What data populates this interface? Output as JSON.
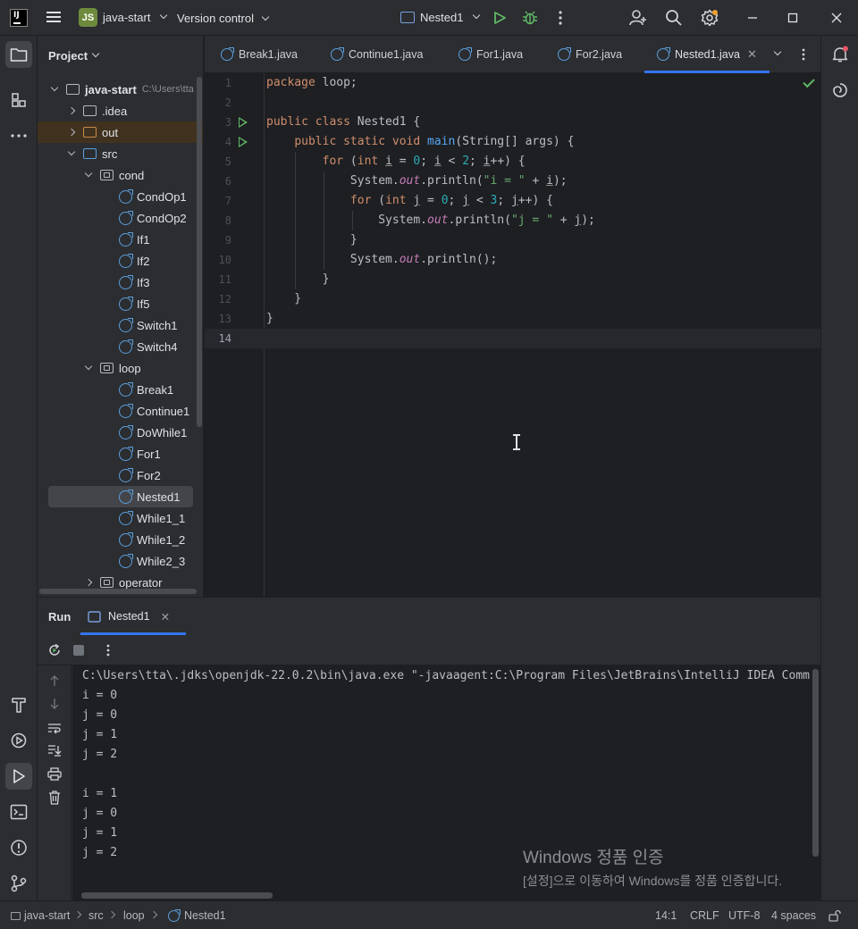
{
  "titlebar": {
    "project_badge": "JS",
    "project_name": "java-start",
    "version_control": "Version control",
    "run_config": "Nested1"
  },
  "project_panel": {
    "title": "Project",
    "root": {
      "name": "java-start",
      "path": "C:\\Users\\tta"
    },
    "items": [
      {
        "label": ".idea",
        "kind": "folder",
        "expanded": false
      },
      {
        "label": "out",
        "kind": "folder-excluded",
        "expanded": false
      },
      {
        "label": "src",
        "kind": "folder",
        "expanded": true
      },
      {
        "label": "cond",
        "kind": "package",
        "expanded": true
      },
      {
        "label": "CondOp1",
        "kind": "class"
      },
      {
        "label": "CondOp2",
        "kind": "class"
      },
      {
        "label": "If1",
        "kind": "class"
      },
      {
        "label": "If2",
        "kind": "class"
      },
      {
        "label": "If3",
        "kind": "class"
      },
      {
        "label": "If5",
        "kind": "class"
      },
      {
        "label": "Switch1",
        "kind": "class"
      },
      {
        "label": "Switch4",
        "kind": "class"
      },
      {
        "label": "loop",
        "kind": "package",
        "expanded": true
      },
      {
        "label": "Break1",
        "kind": "class"
      },
      {
        "label": "Continue1",
        "kind": "class"
      },
      {
        "label": "DoWhile1",
        "kind": "class"
      },
      {
        "label": "For1",
        "kind": "class"
      },
      {
        "label": "For2",
        "kind": "class"
      },
      {
        "label": "Nested1",
        "kind": "class",
        "selected": true
      },
      {
        "label": "While1_1",
        "kind": "class"
      },
      {
        "label": "While1_2",
        "kind": "class"
      },
      {
        "label": "While2_3",
        "kind": "class"
      },
      {
        "label": "operator",
        "kind": "package",
        "expanded": false
      }
    ]
  },
  "editor_tabs": [
    {
      "label": "Break1.java"
    },
    {
      "label": "Continue1.java"
    },
    {
      "label": "For1.java"
    },
    {
      "label": "For2.java"
    },
    {
      "label": "Nested1.java",
      "active": true
    }
  ],
  "editor": {
    "line_numbers": [
      "1",
      "2",
      "3",
      "4",
      "5",
      "6",
      "7",
      "8",
      "9",
      "10",
      "11",
      "12",
      "13",
      "14"
    ],
    "current_line": "14"
  },
  "run_panel": {
    "title": "Run",
    "tab": "Nested1",
    "console": [
      "C:\\Users\\tta\\.jdks\\openjdk-22.0.2\\bin\\java.exe \"-javaagent:C:\\Program Files\\JetBrains\\IntelliJ IDEA Comm",
      "i = 0",
      "j = 0",
      "j = 1",
      "j = 2",
      "",
      "i = 1",
      "j = 0",
      "j = 1",
      "j = 2"
    ],
    "watermark_title": "Windows 정품 인증",
    "watermark_sub": "[설정]으로 이동하여 Windows를 정품 인증합니다."
  },
  "statusbar": {
    "crumbs": [
      "java-start",
      "src",
      "loop",
      "Nested1"
    ],
    "position": "14:1",
    "line_sep": "CRLF",
    "encoding": "UTF-8",
    "indent": "4 spaces"
  },
  "colors": {
    "accent": "#3574f0",
    "run_green": "#5fb865",
    "keyword": "#cf8e6d",
    "number": "#2aacb8",
    "string": "#6aab73",
    "static_field": "#c77dbb",
    "method": "#56a8f5"
  }
}
